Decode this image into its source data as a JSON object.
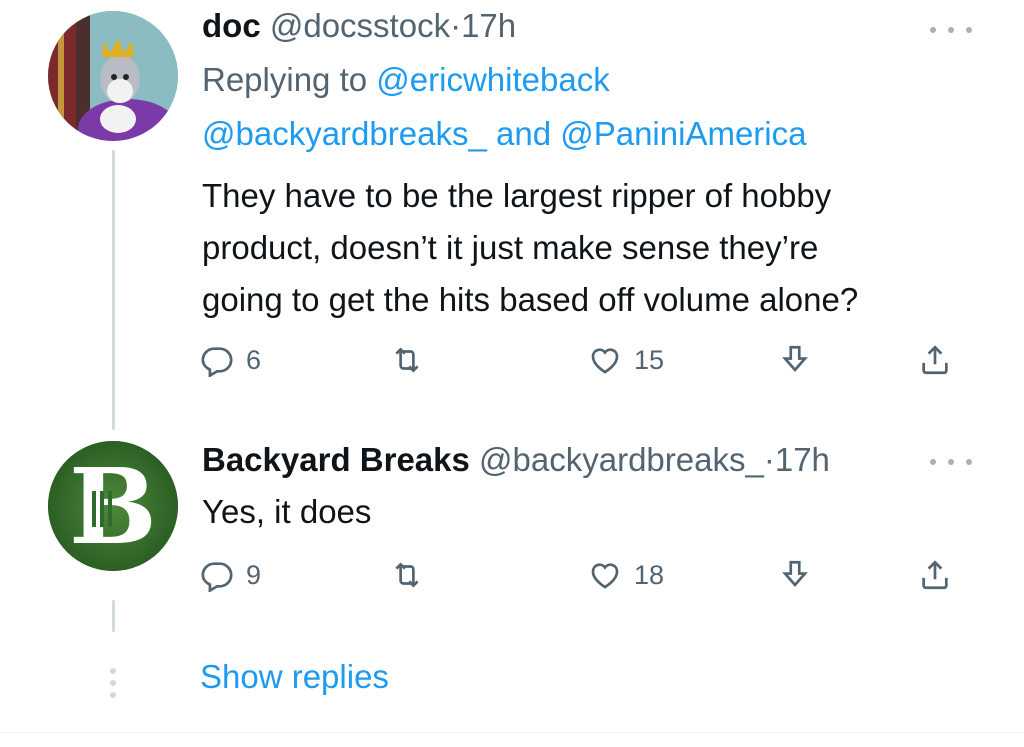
{
  "tweets": [
    {
      "display_name": "doc",
      "handle": "@docsstock",
      "separator": "·",
      "time": "17h",
      "replying_prefix": "Replying to",
      "replying_line1": "@ericwhiteback",
      "replying_line2_a": "@backyardbreaks_",
      "replying_line2_and": "and",
      "replying_line2_b": "@PaniniAmerica",
      "text_lines": [
        "They have to be the largest ripper of hobby",
        "product, doesn’t it just make sense they’re",
        "going to get the hits based off volume alone?"
      ],
      "replies": "6",
      "likes": "15"
    },
    {
      "display_name": "Backyard Breaks",
      "handle": "@backyardbreaks_",
      "separator": "·",
      "time": "17h",
      "text_lines": [
        "Yes, it does"
      ],
      "avatar_letter": "B",
      "replies": "9",
      "likes": "18"
    }
  ],
  "show_replies": "Show replies",
  "icons": {
    "reply": "reply-icon",
    "retweet": "retweet-icon",
    "like": "like-icon",
    "download": "download-icon",
    "share": "share-icon",
    "more": "more-icon"
  },
  "colors": {
    "link": "#1d9bf0",
    "muted": "#536471",
    "text": "#0f1419",
    "thread_line": "#cfd9de"
  }
}
